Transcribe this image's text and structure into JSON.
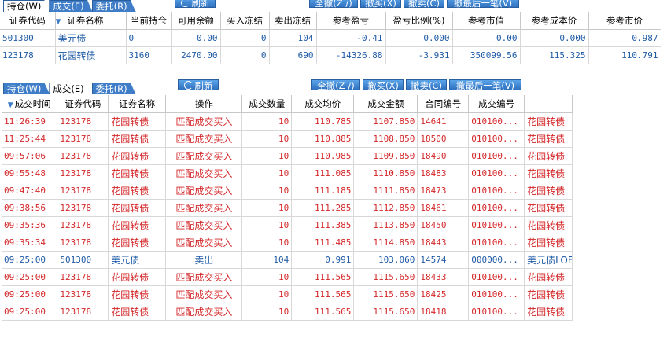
{
  "top_tabs": [
    {
      "label": "持仓(W)",
      "active": true
    },
    {
      "label": "成交(E)",
      "active": false
    },
    {
      "label": "委托(R)",
      "active": false
    }
  ],
  "top_refresh": "刷新",
  "top_buttons": [
    "全撤(Z /)",
    "撤买(X)",
    "撤卖(C)",
    "撤最后一笔(V)"
  ],
  "positions": {
    "headers": [
      "证券代码",
      "证券名称",
      "当前持仓",
      "可用余额",
      "买入冻结",
      "卖出冻结",
      "参考盈亏",
      "盈亏比例(%)",
      "参考市值",
      "参考成本价",
      "参考市价"
    ],
    "rows": [
      [
        "501300",
        "美元债",
        "0",
        "0.00",
        "0",
        "104",
        "-0.41",
        "0.000",
        "0.00",
        "0.000",
        "0.987"
      ],
      [
        "123178",
        "花园转债",
        "3160",
        "2470.00",
        "0",
        "690",
        "-14326.88",
        "-3.931",
        "350099.56",
        "115.325",
        "110.791"
      ]
    ]
  },
  "bottom_tabs": [
    {
      "label": "持仓(W)",
      "active": false
    },
    {
      "label": "成交(E)",
      "active": true
    },
    {
      "label": "委托(R)",
      "active": false
    }
  ],
  "bottom_refresh": "刷新",
  "bottom_buttons": [
    "全撤(Z /)",
    "撤买(X)",
    "撤卖(C)",
    "撤最后一笔(V)"
  ],
  "trades": {
    "headers": [
      "成交时间",
      "证券代码",
      "证券名称",
      "操作",
      "成交数量",
      "成交均价",
      "成交金额",
      "合同编号",
      "成交编号",
      ""
    ],
    "rows": [
      {
        "side": "buy",
        "cells": [
          "11:26:39",
          "123178",
          "花园转债",
          "匹配成交买入",
          "10",
          "110.785",
          "1107.850",
          "14641",
          "010100...",
          "花园转债"
        ]
      },
      {
        "side": "buy",
        "cells": [
          "11:25:44",
          "123178",
          "花园转债",
          "匹配成交买入",
          "10",
          "110.885",
          "1108.850",
          "18500",
          "010100...",
          "花园转债"
        ]
      },
      {
        "side": "buy",
        "cells": [
          "09:57:06",
          "123178",
          "花园转债",
          "匹配成交买入",
          "10",
          "110.985",
          "1109.850",
          "18490",
          "010100...",
          "花园转债"
        ]
      },
      {
        "side": "buy",
        "cells": [
          "09:55:48",
          "123178",
          "花园转债",
          "匹配成交买入",
          "10",
          "111.085",
          "1110.850",
          "18483",
          "010100...",
          "花园转债"
        ]
      },
      {
        "side": "buy",
        "cells": [
          "09:47:40",
          "123178",
          "花园转债",
          "匹配成交买入",
          "10",
          "111.185",
          "1111.850",
          "18473",
          "010100...",
          "花园转债"
        ]
      },
      {
        "side": "buy",
        "cells": [
          "09:38:56",
          "123178",
          "花园转债",
          "匹配成交买入",
          "10",
          "111.285",
          "1112.850",
          "18461",
          "010100...",
          "花园转债"
        ]
      },
      {
        "side": "buy",
        "cells": [
          "09:35:36",
          "123178",
          "花园转债",
          "匹配成交买入",
          "10",
          "111.385",
          "1113.850",
          "18450",
          "010100...",
          "花园转债"
        ]
      },
      {
        "side": "buy",
        "cells": [
          "09:35:34",
          "123178",
          "花园转债",
          "匹配成交买入",
          "10",
          "111.485",
          "1114.850",
          "18443",
          "010100...",
          "花园转债"
        ]
      },
      {
        "side": "sell",
        "cells": [
          "09:25:00",
          "501300",
          "美元债",
          "卖出",
          "104",
          "0.991",
          "103.060",
          "14574",
          "000000...",
          "美元债LOF"
        ]
      },
      {
        "side": "buy",
        "cells": [
          "09:25:00",
          "123178",
          "花园转债",
          "匹配成交买入",
          "10",
          "111.565",
          "1115.650",
          "18433",
          "010100...",
          "花园转债"
        ]
      },
      {
        "side": "buy",
        "cells": [
          "09:25:00",
          "123178",
          "花园转债",
          "匹配成交买入",
          "10",
          "111.565",
          "1115.650",
          "18425",
          "010100...",
          "花园转债"
        ]
      },
      {
        "side": "buy",
        "cells": [
          "09:25:00",
          "123178",
          "花园转债",
          "匹配成交买入",
          "10",
          "111.565",
          "1115.650",
          "18418",
          "010100...",
          "花园转债"
        ]
      }
    ]
  }
}
